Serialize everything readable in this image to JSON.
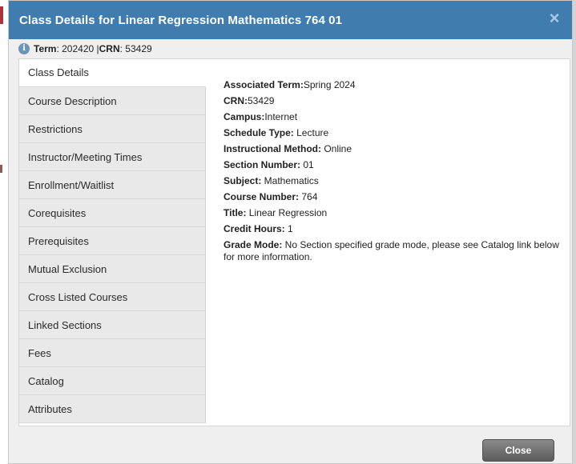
{
  "dialog": {
    "title": "Class Details for Linear Regression Mathematics 764 01",
    "close_icon": "×",
    "close_button_label": "Close"
  },
  "term_info": {
    "term_label": "Term",
    "term_value": ": 202420 | ",
    "crn_label": "CRN",
    "crn_value": ": 53429"
  },
  "tabs": [
    {
      "label": "Class Details",
      "active": true
    },
    {
      "label": "Course Description"
    },
    {
      "label": "Restrictions"
    },
    {
      "label": "Instructor/Meeting Times"
    },
    {
      "label": "Enrollment/Waitlist"
    },
    {
      "label": "Corequisites"
    },
    {
      "label": "Prerequisites"
    },
    {
      "label": "Mutual Exclusion"
    },
    {
      "label": "Cross Listed Courses"
    },
    {
      "label": "Linked Sections"
    },
    {
      "label": "Fees"
    },
    {
      "label": "Catalog"
    },
    {
      "label": "Attributes"
    }
  ],
  "details": {
    "associated_term_label": "Associated Term:",
    "associated_term_value": "Spring 2024",
    "crn_label": "CRN:",
    "crn_value": "53429",
    "campus_label": "Campus:",
    "campus_value": "Internet",
    "schedule_type_label": "Schedule Type:",
    "schedule_type_value": " Lecture",
    "instructional_method_label": "Instructional Method:",
    "instructional_method_value": " Online",
    "section_number_label": "Section Number:",
    "section_number_value": " 01",
    "subject_label": "Subject:",
    "subject_value": " Mathematics",
    "course_number_label": "Course Number:",
    "course_number_value": " 764",
    "title_label": "Title:",
    "title_value": " Linear Regression",
    "credit_hours_label": "Credit Hours:",
    "credit_hours_value": " 1",
    "grade_mode_label": "Grade Mode:",
    "grade_mode_value": " No Section specified grade mode, please see Catalog link below for more information."
  },
  "colors": {
    "titlebar": "#417caf",
    "info_icon": "#6d94bd"
  }
}
